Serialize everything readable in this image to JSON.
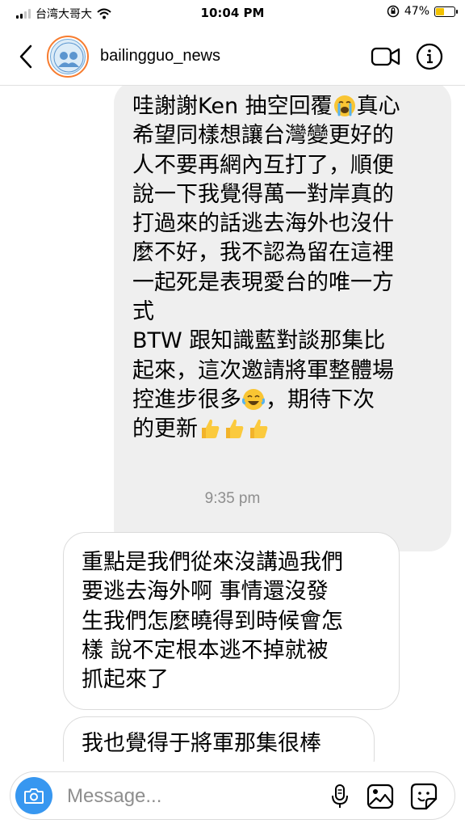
{
  "status_bar": {
    "carrier": "台湾大哥大",
    "time": "10:04 PM",
    "battery_percent": "47%",
    "battery_level": 0.47,
    "battery_color": "#f2c200",
    "signal_bars": 2,
    "icons": [
      "signal-icon",
      "wifi-icon",
      "rotation-lock-icon",
      "battery-icon"
    ]
  },
  "header": {
    "username": "bailingguo_news",
    "story_ring_color": "#f77c2f",
    "icons": [
      "chevron-left-icon",
      "video-camera-icon",
      "info-icon"
    ]
  },
  "thread": {
    "outgoing_message": {
      "lines": [
        "哇謝謝Ken 抽空回覆",
        "希望同樣想讓台灣變更好的",
        "人不要再網內互打了，順便",
        "說一下我覺得萬一對岸真的",
        "打過來的話逃去海外也沒什",
        "麼不好，我不認為留在這裡",
        "一起死是表現愛台的唯一方",
        "式",
        "BTW 跟知識藍對談那集比",
        "起來，這次邀請將軍整體場",
        "控進步很多",
        "，期待下次",
        "的更新"
      ],
      "line1_suffix": "真心",
      "emojis": [
        "loudly-crying-face-emoji",
        "face-with-tears-of-joy-emoji",
        "thumbs-up-emoji"
      ]
    },
    "timestamp": "9:35 pm",
    "incoming_messages": [
      {
        "lines": [
          "重點是我們從來沒講過我們",
          "要逃去海外啊 事情還沒發",
          "生我們怎麼曉得到時候會怎",
          "樣 說不定根本逃不掉就被",
          "抓起來了"
        ]
      },
      {
        "lines": [
          "我也覺得于將軍那集很棒"
        ]
      }
    ]
  },
  "composer": {
    "placeholder": "Message...",
    "value": "",
    "camera_color": "#3797f0",
    "icons": [
      "camera-icon",
      "microphone-icon",
      "gallery-icon",
      "sticker-icon"
    ]
  }
}
